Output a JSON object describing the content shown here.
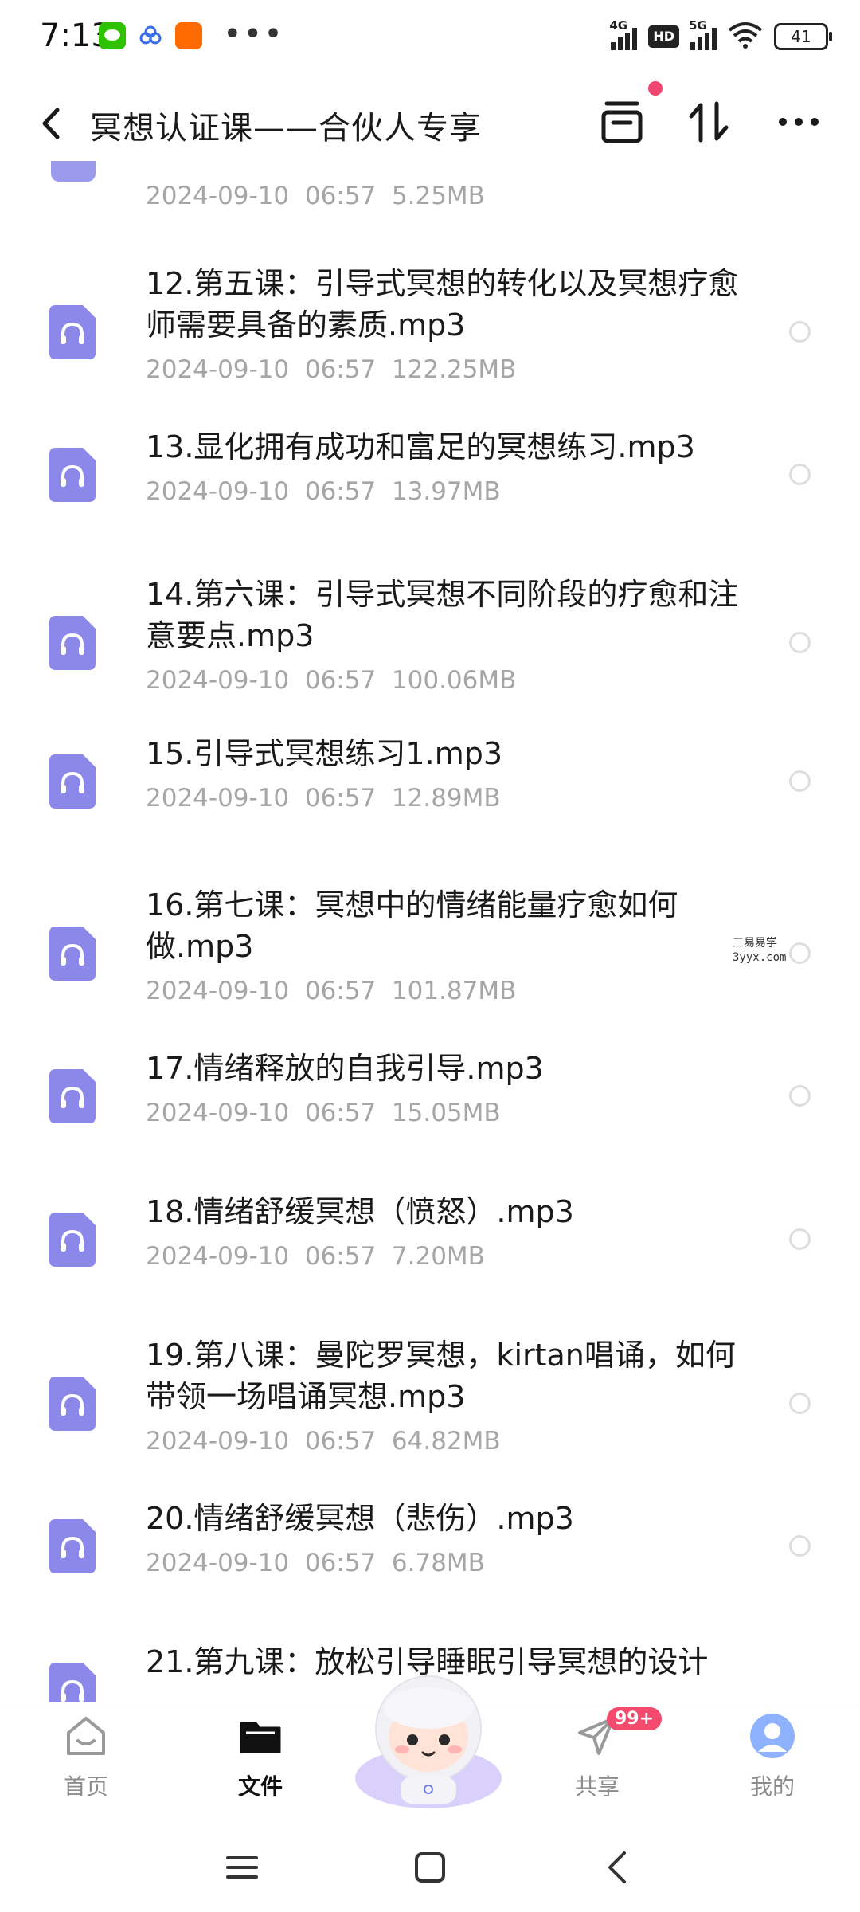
{
  "status_bar": {
    "time": "7:13",
    "net1": "4G",
    "hd": "HD",
    "net2": "5G",
    "battery": "41"
  },
  "header": {
    "title": "冥想认证课——合伙人专享"
  },
  "partial_row": {
    "meta": "2024-09-10  06:57  5.25MB"
  },
  "files": [
    {
      "name": "12.第五课：引导式冥想的转化以及冥想疗愈师需要具备的素质.mp3",
      "meta": "2024-09-10  06:57  122.25MB"
    },
    {
      "name": "13.显化拥有成功和富足的冥想练习.mp3",
      "meta": "2024-09-10  06:57  13.97MB"
    },
    {
      "name": "14.第六课：引导式冥想不同阶段的疗愈和注意要点.mp3",
      "meta": "2024-09-10  06:57  100.06MB"
    },
    {
      "name": "15.引导式冥想练习1.mp3",
      "meta": "2024-09-10  06:57  12.89MB"
    },
    {
      "name": "16.第七课：冥想中的情绪能量疗愈如何做.mp3",
      "meta": "2024-09-10  06:57  101.87MB"
    },
    {
      "name": "17.情绪释放的自我引导.mp3",
      "meta": "2024-09-10  06:57  15.05MB"
    },
    {
      "name": "18.情绪舒缓冥想（愤怒）.mp3",
      "meta": "2024-09-10  06:57  7.20MB"
    },
    {
      "name": "19.第八课：曼陀罗冥想，kirtan唱诵，如何带领一场唱诵冥想.mp3",
      "meta": "2024-09-10  06:57  64.82MB"
    },
    {
      "name": "20.情绪舒缓冥想（悲伤）.mp3",
      "meta": "2024-09-10  06:57  6.78MB"
    },
    {
      "name": "21.第九课：放松引导睡眠引导冥想的设计",
      "meta": ""
    }
  ],
  "watermark": {
    "line1": "三易易学",
    "line2": "3yyx.com"
  },
  "bottom_nav": {
    "home": "首页",
    "files": "文件",
    "share": "共享",
    "share_badge": "99+",
    "mine": "我的"
  },
  "colors": {
    "file_icon": "#8b88ea",
    "badge": "#f44a6e",
    "meta_text": "#a6a6a6"
  },
  "icons": {
    "file": "headphones-audio-file-icon",
    "back": "chevron-left-icon",
    "transfer": "transfer-list-icon",
    "sort": "sort-arrows-icon",
    "more": "more-dots-icon"
  }
}
